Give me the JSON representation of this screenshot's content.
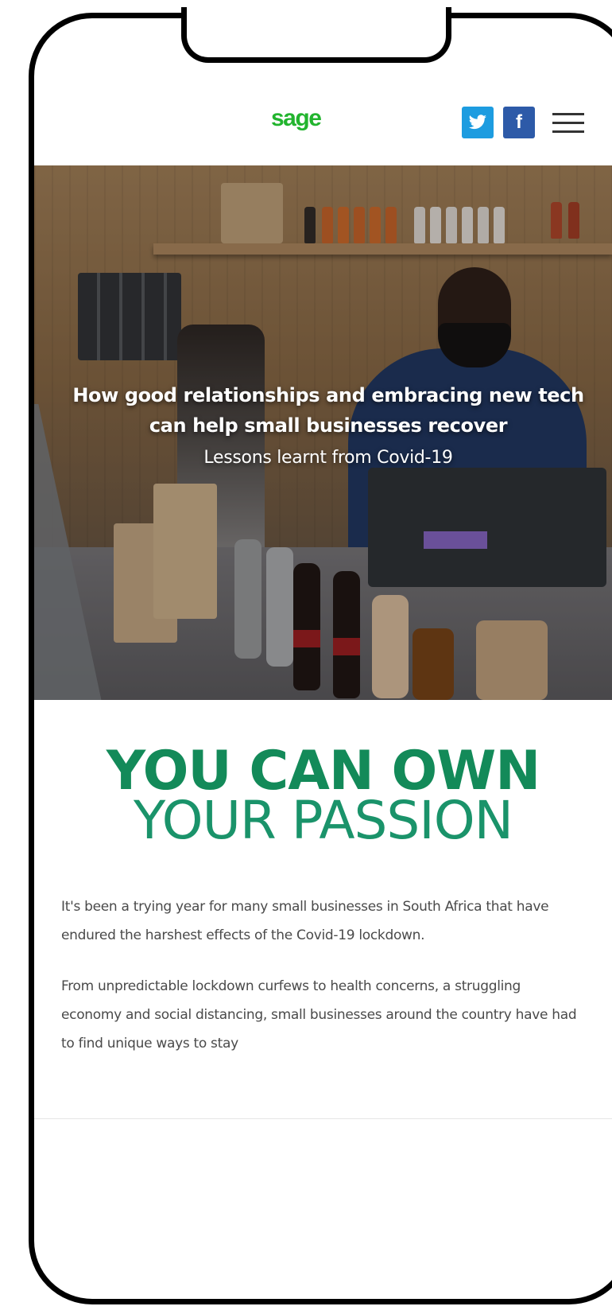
{
  "header": {
    "logo": "sage",
    "twitter_glyph": "🐦",
    "facebook_glyph": "f",
    "menu_icon": "hamburger-menu-icon"
  },
  "hero": {
    "title": "How good relationships and embracing new tech can help small businesses recover",
    "subtitle": "Lessons learnt from Covid-19"
  },
  "headline": {
    "line1": "YOU CAN OWN",
    "line2": "YOUR PASSION"
  },
  "body": {
    "paragraph1": "It's been a trying year for many small businesses in South Africa that have endured the harshest effects of the Covid-19 lockdown.",
    "paragraph2": "From unpredictable lockdown curfews to health concerns, a struggling economy and social distancing, small businesses around the country have had to find unique ways to stay"
  },
  "colors": {
    "logo_green": "#22b42e",
    "heading_green": "#138a59",
    "twitter_blue": "#1d9ce0",
    "facebook_blue": "#2d5aa8"
  }
}
